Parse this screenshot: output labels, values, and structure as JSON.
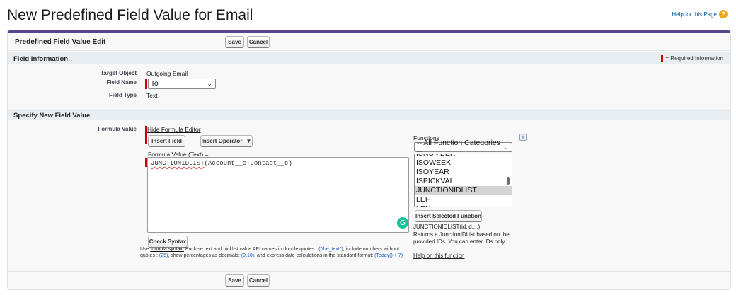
{
  "page": {
    "title": "New Predefined Field Value for Email",
    "help_link": "Help for this Page",
    "help_icon": "question-circle-icon",
    "accent_color": "#56458c"
  },
  "panel": {
    "title": "Predefined Field Value Edit",
    "save_label": "Save",
    "cancel_label": "Cancel"
  },
  "field_info": {
    "heading": "Field Information",
    "required_legend": "= Required Information",
    "target_object_label": "Target Object",
    "target_object_value": "Outgoing Email",
    "field_name_label": "Field Name",
    "field_name_value": "To",
    "field_type_label": "Field Type",
    "field_type_value": "Text"
  },
  "new_value": {
    "heading": "Specify New Field Value",
    "formula_value_label": "Formula Value",
    "hide_editor_link": "Hide Formula Editor",
    "insert_field_label": "Insert Field",
    "insert_operator_label": "Insert Operator",
    "formula_text_label": "Formula Value (Text) =",
    "formula_function": "JUNCTIONIDLIST",
    "formula_args": "(Account__c.Contact__c)",
    "check_syntax_label": "Check Syntax",
    "syntax_help": {
      "prefix": "Use ",
      "link": "formula syntax:",
      "text1": " Enclose text and picklist value API names in double quotes : ",
      "ex1": "(\"the_text\")",
      "text2": ", include numbers without quotes : ",
      "ex2": "(25)",
      "text3": ", show percentages as decimals: ",
      "ex3": "(0.10)",
      "text4": ", and express date calculations in the standard format: ",
      "ex4": "(Today() + 7)"
    }
  },
  "functions": {
    "label": "Functions",
    "category_selected": "-- All Function Categories --",
    "items": [
      "ISNUMBER",
      "ISOWEEK",
      "ISOYEAR",
      "ISPICKVAL",
      "JUNCTIONIDLIST",
      "LEFT",
      "LEN"
    ],
    "selected_item": "JUNCTIONIDLIST",
    "insert_selected_label": "Insert Selected Function",
    "signature": "JUNCTIONIDLIST(id,id,...)",
    "description": "Returns a JunctionIDList based on the provided IDs. You can enter IDs only.",
    "help_link": "Help on this function"
  },
  "footer": {
    "save_label": "Save",
    "cancel_label": "Cancel"
  }
}
